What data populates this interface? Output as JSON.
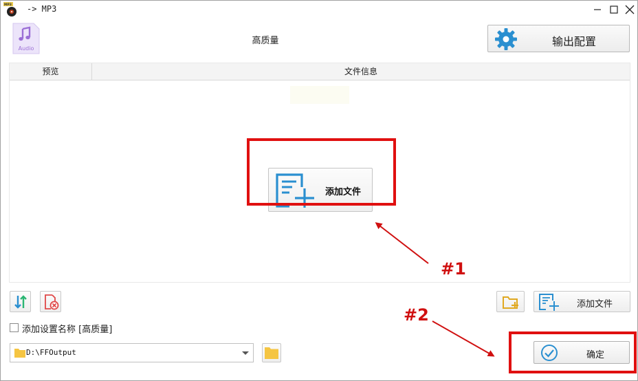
{
  "window": {
    "title": "-> MP3",
    "app_icon_badge": "MP3"
  },
  "header": {
    "format_icon_label": "Audio",
    "profile_name": "高质量",
    "output_config_label": "输出配置"
  },
  "file_list": {
    "columns": [
      "预览",
      "文件信息"
    ],
    "add_file_label": "添加文件"
  },
  "toolbar": {
    "add_file_label": "添加文件"
  },
  "options": {
    "append_name_label": "添加设置名称 [高质量]",
    "append_name_checked": false
  },
  "output": {
    "path": "D:\\FFOutput"
  },
  "actions": {
    "ok_label": "确定"
  },
  "annotations": {
    "label_1": "#1",
    "label_2": "#2"
  },
  "colors": {
    "accent_blue": "#2a8fd0",
    "annotation_red": "#e01010",
    "audio_purple": "#9b6fd6",
    "folder_yellow": "#f5c542"
  }
}
